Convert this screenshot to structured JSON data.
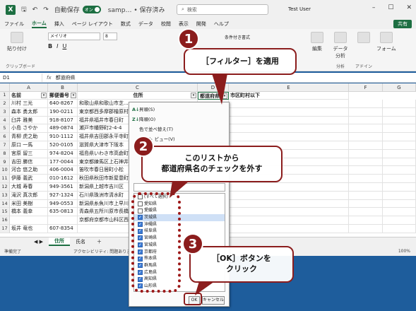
{
  "titlebar": {
    "autosave_label": "自動保存",
    "autosave_state": "オン",
    "filename": "samp… • 保存済み",
    "search_placeholder": "検索",
    "user": "Test User"
  },
  "menu": [
    "ファイル",
    "ホーム",
    "挿入",
    "ページ レイアウト",
    "数式",
    "データ",
    "校閲",
    "表示",
    "開発",
    "ヘルプ"
  ],
  "share_label": "共有",
  "ribbon": {
    "paste": "貼り付け",
    "clipboard": "クリップボード",
    "font_name": "メイリオ",
    "font_size": "8",
    "conditional": "条件付き書式",
    "edit": "編集",
    "analyze_data": "データ分析",
    "analysis": "分析",
    "addin": "アドイン",
    "form": "フォーム"
  },
  "formula": {
    "namebox": "D1",
    "fx": "fx",
    "value": "都道府県"
  },
  "columns": [
    "A",
    "B",
    "C",
    "D",
    "E",
    "F",
    "G"
  ],
  "headers": [
    "名前",
    "郵便番号",
    "住所",
    "都道府県",
    "市区町村以下"
  ],
  "rows": [
    [
      "1",
      "",
      "",
      "",
      ""
    ],
    [
      "2",
      "川村 三光",
      "640-8267",
      "和歌山県和歌山市芝..."
    ],
    [
      "3",
      "森本 勇太郎",
      "190-0211",
      "東京都西多摩郡檜原村"
    ],
    [
      "4",
      "臼井 雅美",
      "918-8107",
      "福井県福井市春日町"
    ],
    [
      "5",
      "小島 さやか",
      "489-0874",
      "瀬戸市幡野町2-4-4"
    ],
    [
      "6",
      "青柳 虎之助",
      "910-1112",
      "福井県吉田郡永平寺町"
    ],
    [
      "7",
      "原口 一馬",
      "520-0105",
      "滋賀県大津市下阪本"
    ],
    [
      "8",
      "宮原 留三",
      "974-8204",
      "福島県いわき市高倉町"
    ],
    [
      "9",
      "吉田 勝信",
      "177-0044",
      "東京都練馬区上石神井"
    ],
    [
      "10",
      "河合 悠之助",
      "406-0004",
      "笛吹市春日居町小松"
    ],
    [
      "11",
      "伊藤 義武",
      "010-1612",
      "秋田県秋田市新屋豊町"
    ],
    [
      "12",
      "大城 寿春",
      "949-3561",
      "新潟県上越市吉川区"
    ],
    [
      "13",
      "滝沢 真次郎",
      "927-1324",
      "石川県珠洲市清水町"
    ],
    [
      "14",
      "米田 美樹",
      "949-0553",
      "新潟県糸魚川市上早川"
    ],
    [
      "15",
      "橋本 義幸",
      "635-0813",
      "青森県五所川原市長橋"
    ],
    [
      "16",
      "",
      "",
      "京都府京都市山科区西"
    ],
    [
      "17",
      "坂井 竜也",
      "607-8354",
      ""
    ]
  ],
  "tabs": [
    "住所",
    "氏名"
  ],
  "status": [
    "準備完了",
    "アクセシビリティ: 問題ありません",
    "100%"
  ],
  "dropdown": {
    "sort_asc": "昇順(S)",
    "sort_desc": "降順(O)",
    "sort_color": "色で並べ替え(T)",
    "sheet_view": "シート ビュー(V)",
    "list": [
      {
        "label": "(すべて選択)",
        "checked": false,
        "highlight": false
      },
      {
        "label": "愛知県",
        "checked": false,
        "highlight": false
      },
      {
        "label": "愛媛県",
        "checked": false,
        "highlight": false
      },
      {
        "label": "茨城県",
        "checked": true,
        "highlight": true
      },
      {
        "label": "沖縄県",
        "checked": true,
        "highlight": false
      },
      {
        "label": "岐阜県",
        "checked": true,
        "highlight": false
      },
      {
        "label": "宮崎県",
        "checked": true,
        "highlight": false
      },
      {
        "label": "宮城県",
        "checked": true,
        "highlight": false
      },
      {
        "label": "京都府",
        "checked": true,
        "highlight": false
      },
      {
        "label": "熊本県",
        "checked": true,
        "highlight": false
      },
      {
        "label": "群馬県",
        "checked": true,
        "highlight": false
      },
      {
        "label": "広島県",
        "checked": true,
        "highlight": false
      },
      {
        "label": "高知県",
        "checked": true,
        "highlight": false
      },
      {
        "label": "山形県",
        "checked": true,
        "highlight": false
      }
    ],
    "ok": "OK",
    "cancel": "キャンセル"
  },
  "callouts": {
    "one_number": "1",
    "one_text": "［フィルター］を適用",
    "two_number": "2",
    "two_line1": "このリストから",
    "two_line2": "都道府県名のチェックを外す",
    "three_number": "3",
    "three_line1": "［OK］ボタンを",
    "three_line2": "クリック"
  },
  "colors": {
    "excel_green": "#1d6f42",
    "callout_red": "#8b1d1d",
    "background": "#1e5d9c"
  }
}
